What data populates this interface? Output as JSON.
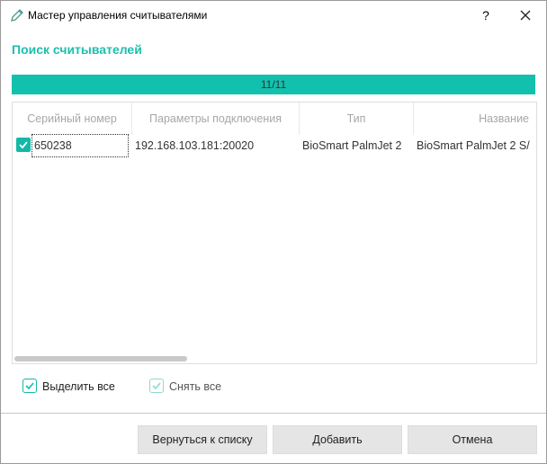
{
  "window": {
    "title": "Мастер управления считывателями",
    "help_label": "?",
    "icon": "pencil-icon"
  },
  "section_title": "Поиск считывателей",
  "progress": {
    "text": "11/11",
    "fraction": 1.0,
    "color": "#12c1ad"
  },
  "table": {
    "columns": [
      "Серийный номер",
      "Параметры подключения",
      "Тип",
      "Название"
    ],
    "rows": [
      {
        "checked": true,
        "serial": "650238",
        "connection": "192.168.103.181:20020",
        "type": "BioSmart PalmJet 2",
        "name": "BioSmart PalmJet 2 S/"
      }
    ]
  },
  "checkboxes": {
    "select_all": "Выделить все",
    "deselect_all": "Снять все"
  },
  "buttons": {
    "back": "Вернуться к списку",
    "add": "Добавить",
    "cancel": "Отмена"
  },
  "colors": {
    "accent": "#14b8a6",
    "title": "#1dbfae"
  }
}
